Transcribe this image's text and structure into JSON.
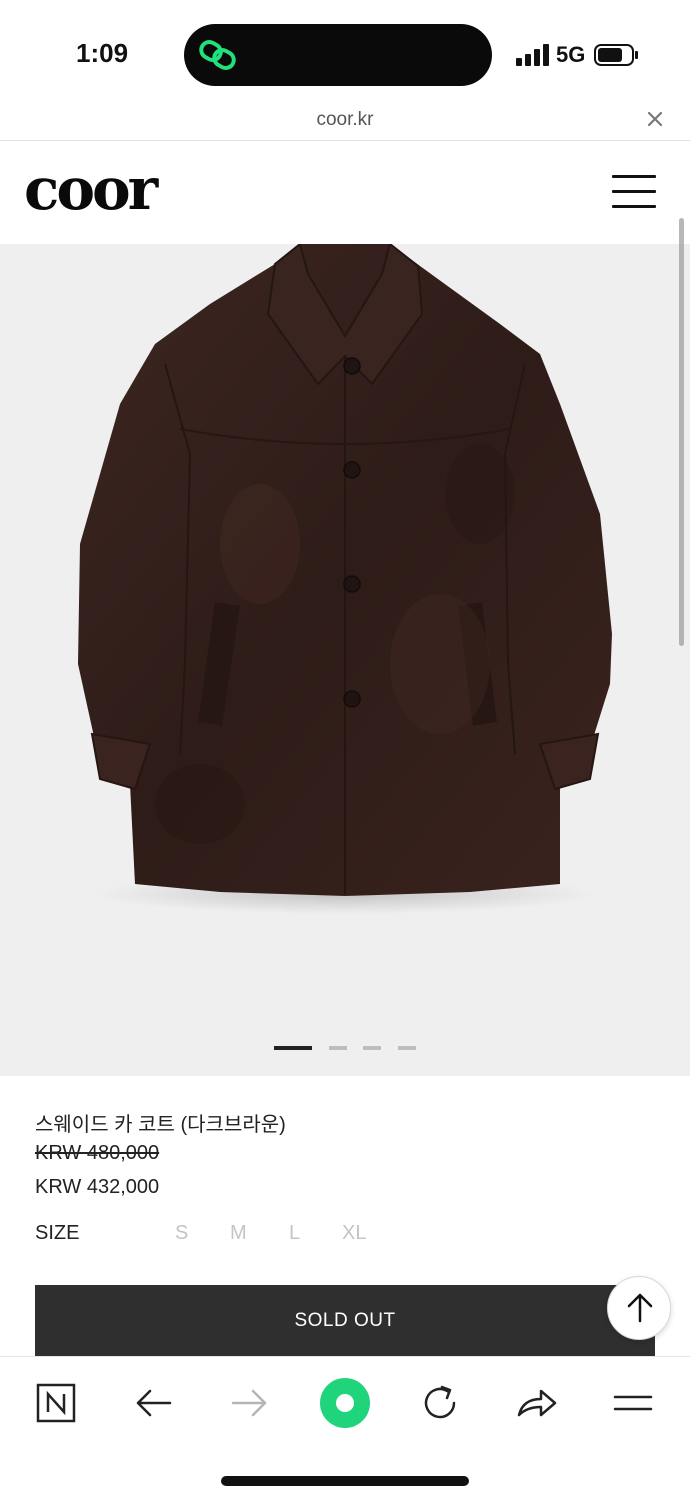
{
  "status_bar": {
    "time": "1:09",
    "network": "5G"
  },
  "browser": {
    "url": "coor.kr"
  },
  "site": {
    "logo_text": "coor"
  },
  "carousel": {
    "total_slides": 4,
    "active_slide": 1
  },
  "product": {
    "name": "스웨이드 카 코트 (다크브라운)",
    "price_original": "KRW 480,000",
    "price_sale": "KRW 432,000",
    "size_label": "SIZE",
    "sizes": [
      "S",
      "M",
      "L",
      "XL"
    ],
    "sold_out_label": "SOLD OUT"
  },
  "colors": {
    "accent_green": "#1fd47a",
    "button_dark": "#2f2f2f",
    "coat_brown": "#3a2520"
  },
  "bottom_bar_icons": [
    "naver-n-icon",
    "back-arrow-icon",
    "forward-arrow-icon",
    "green-dot-icon",
    "refresh-icon",
    "share-icon",
    "menu-icon"
  ]
}
